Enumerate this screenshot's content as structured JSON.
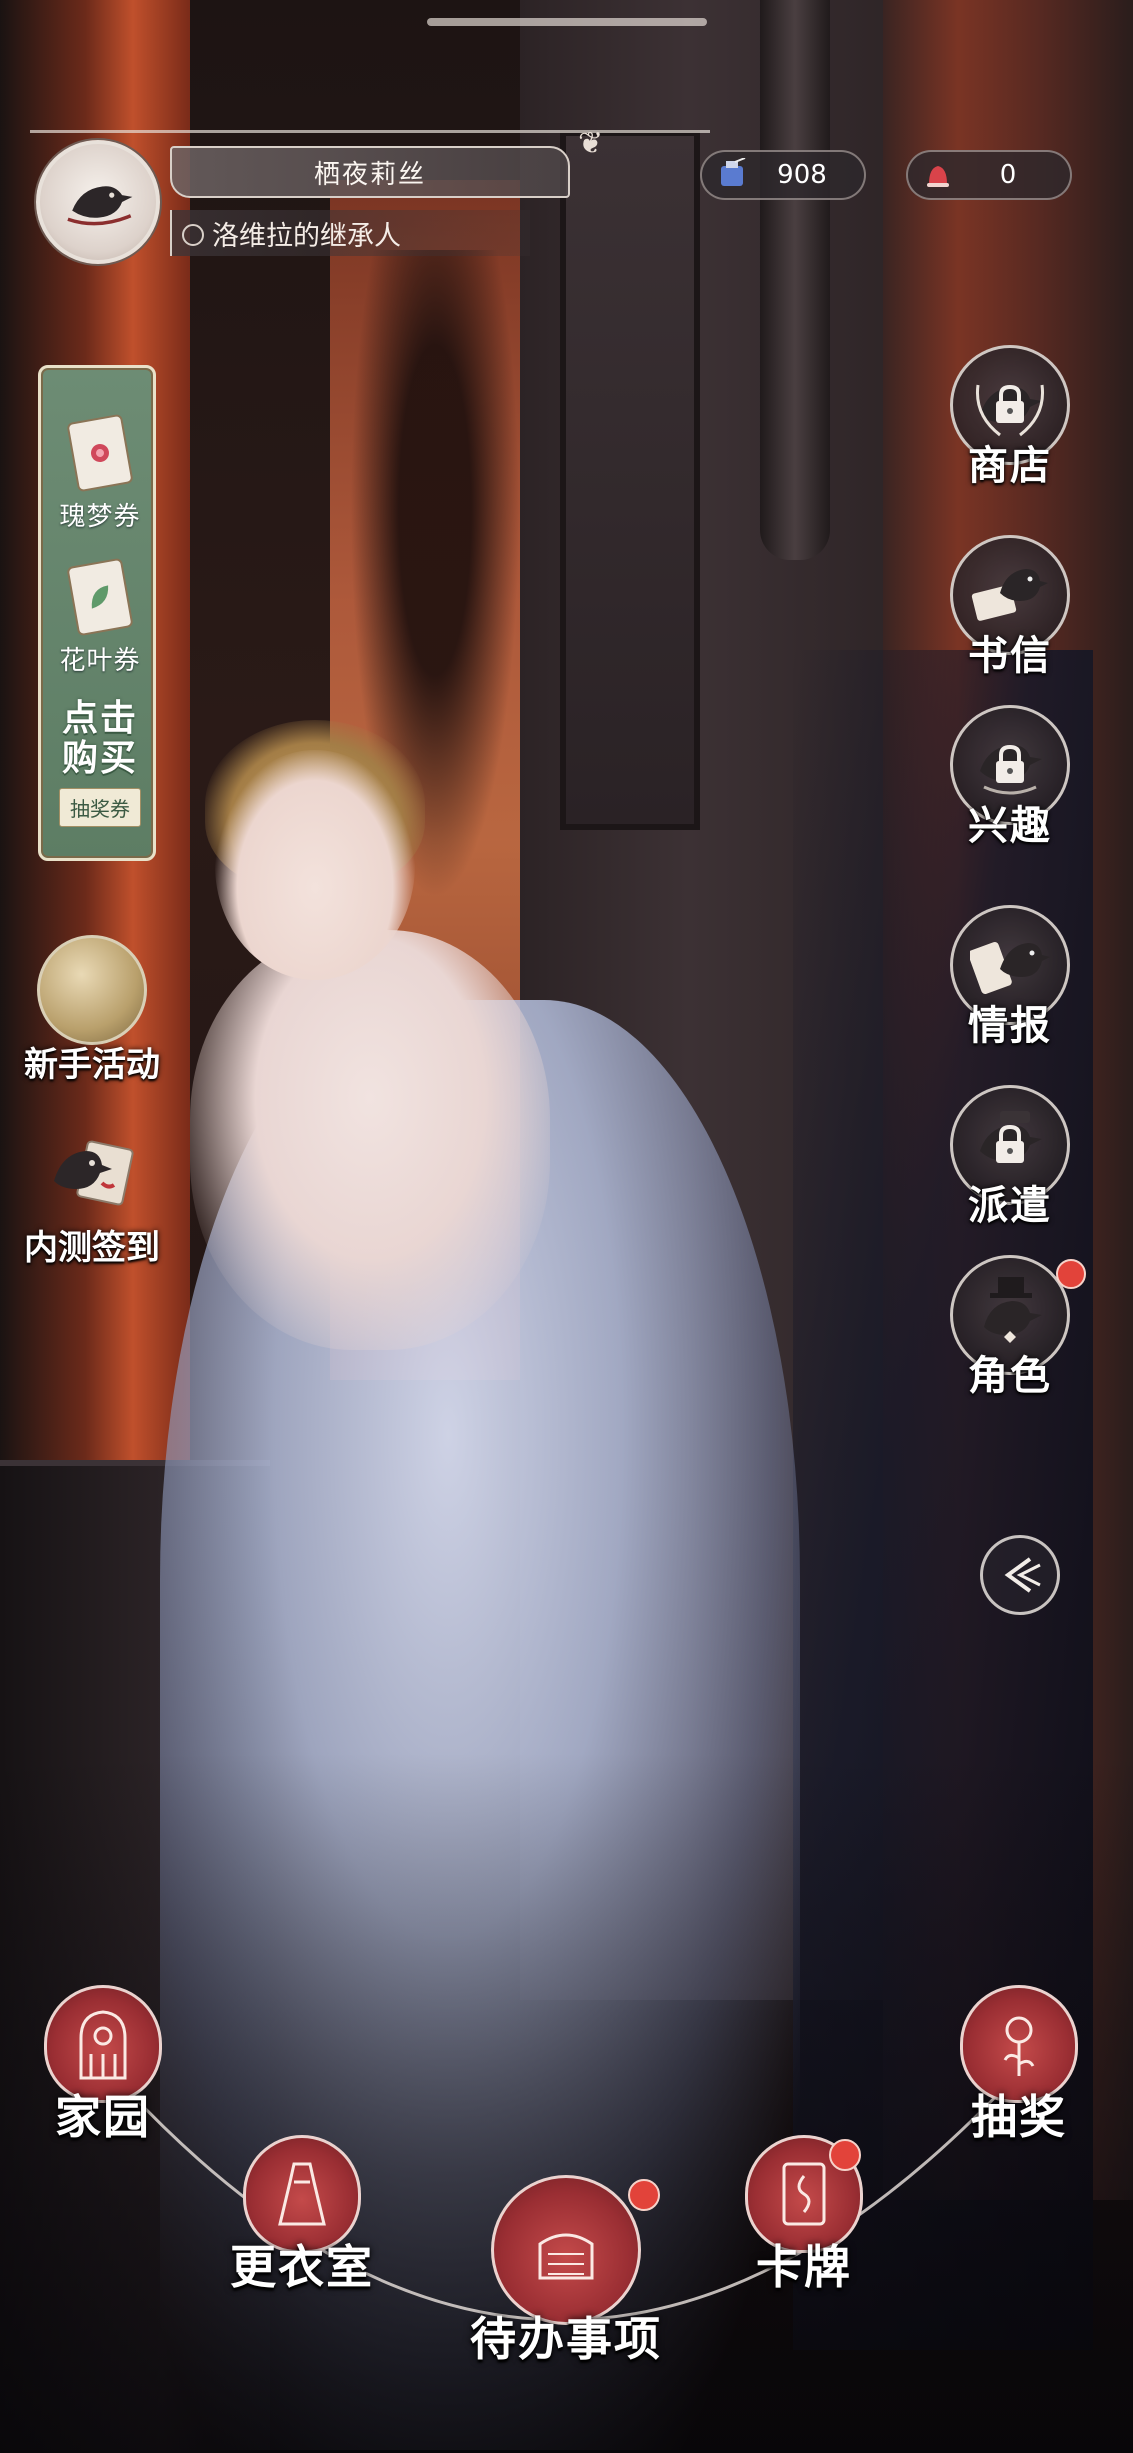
{
  "player": {
    "name": "栖夜莉丝",
    "title": "洛维拉的继承人",
    "avatar_icon": "crow-avatar-icon"
  },
  "currencies": [
    {
      "icon": "ink-bottle-icon",
      "value": "908"
    },
    {
      "icon": "red-bell-icon",
      "value": "0"
    }
  ],
  "shop_panel": {
    "tickets": [
      {
        "label": "瑰梦券",
        "icon": "rose-card-icon"
      },
      {
        "label": "花叶券",
        "icon": "leaf-card-icon"
      }
    ],
    "buy_label": "点击购买",
    "buy_tag": "抽奖券"
  },
  "left_events": [
    {
      "label": "新手活动",
      "icon": "golden-orb-icon"
    },
    {
      "label": "内测签到",
      "icon": "crow-scroll-icon"
    }
  ],
  "right_menu": [
    {
      "label": "商店",
      "icon": "crow-laurel-icon",
      "locked": true,
      "badge": false
    },
    {
      "label": "书信",
      "icon": "crow-letter-icon",
      "locked": false,
      "badge": false
    },
    {
      "label": "兴趣",
      "icon": "crow-hobby-icon",
      "locked": true,
      "badge": false
    },
    {
      "label": "情报",
      "icon": "crow-scroll-icon",
      "locked": false,
      "badge": false
    },
    {
      "label": "派遣",
      "icon": "crow-dispatch-icon",
      "locked": true,
      "badge": false
    },
    {
      "label": "角色",
      "icon": "crow-tophat-icon",
      "locked": false,
      "badge": true
    }
  ],
  "bottom_nav": [
    {
      "label": "家园",
      "icon": "gothic-window-icon",
      "badge": false
    },
    {
      "label": "更衣室",
      "icon": "dress-icon",
      "badge": false
    },
    {
      "label": "待办事项",
      "icon": "building-icon",
      "badge": true
    },
    {
      "label": "卡牌",
      "icon": "card-icon",
      "badge": true
    },
    {
      "label": "抽奖",
      "icon": "rose-icon",
      "badge": false
    }
  ],
  "colors": {
    "badge_red": "#e2433a",
    "nav_red": "#9a2e33",
    "panel_green": "#5d7d64"
  }
}
